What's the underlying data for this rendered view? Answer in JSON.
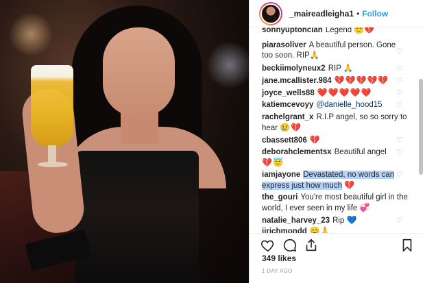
{
  "post": {
    "username": "_maireadleigha1",
    "separator": "•",
    "follow_label": "Follow",
    "likes": "349 likes",
    "time": "1 DAY AGO"
  },
  "icons": {
    "like": "heart-outline-icon",
    "comment": "comment-bubble-icon",
    "share": "share-icon",
    "save": "bookmark-icon",
    "comment_like": "heart-outline-icon"
  },
  "colors": {
    "follow": "#3897f0",
    "text": "#262626",
    "highlight": "#b5d2f7"
  },
  "comments": [
    {
      "user": "sonnyuptoncian",
      "text": "Legend",
      "emoji": "😇💔"
    },
    {
      "user": "piarasoliver",
      "text": "A beautiful person. Gone too soon. RIP",
      "emoji": "🙏"
    },
    {
      "user": "beckiimolyneux2",
      "text": "RIP",
      "emoji": "🙏"
    },
    {
      "user": "jane.mcallister.984",
      "text": "",
      "emoji": "💔💔💔💔💔"
    },
    {
      "user": "joyce_wells88",
      "text": "",
      "emoji": "❤️❤️❤️❤️❤️"
    },
    {
      "user": "katiemcevoyy",
      "text": "@danielle_hood15",
      "emoji": ""
    },
    {
      "user": "rachelgrant_x",
      "text": "R.I.P angel, so so sorry to hear",
      "emoji": "😢💔"
    },
    {
      "user": "cbassett806",
      "text": "",
      "emoji": "💔"
    },
    {
      "user": "deborahclementsx",
      "text": "Beautiful angel",
      "emoji": "💔😇"
    },
    {
      "user": "iamjayone",
      "text": "Devastated, no words can express just how much",
      "emoji": "💔"
    },
    {
      "user": "the_gouri",
      "text": "You're most beautiful girl in the world, I ever seen in my life",
      "emoji": "💞"
    },
    {
      "user": "natalie_harvey_23",
      "text": "Rip",
      "emoji": "💙"
    },
    {
      "user": "jjrichmondd",
      "text": "",
      "emoji": "😊🙏"
    }
  ]
}
